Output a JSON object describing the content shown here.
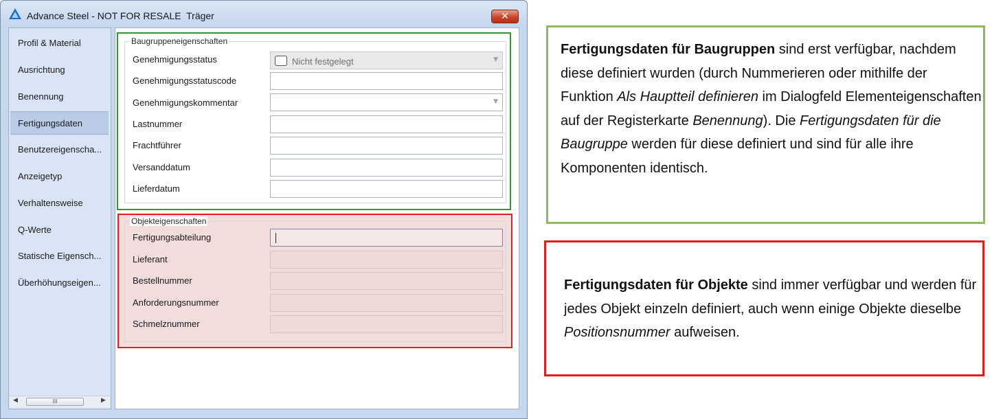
{
  "window": {
    "title": "Advance Steel - NOT FOR RESALE  Träger",
    "close_symbol": "✕"
  },
  "sidebar": {
    "items": [
      {
        "label": "Profil & Material"
      },
      {
        "label": "Ausrichtung"
      },
      {
        "label": "Benennung"
      },
      {
        "label": "Fertigungsdaten",
        "selected": true
      },
      {
        "label": "Benutzereigenscha..."
      },
      {
        "label": "Anzeigetyp"
      },
      {
        "label": "Verhaltensweise"
      },
      {
        "label": "Q-Werte"
      },
      {
        "label": "Statische Eigensch..."
      },
      {
        "label": "Überhöhungseigen..."
      }
    ],
    "scroll_left": "◀",
    "scroll_right": "▶",
    "scroll_thumb_grip": "III"
  },
  "assembly_group": {
    "legend": "Baugruppeneigenschaften",
    "fields": {
      "approval_status": {
        "label": "Genehmigungsstatus",
        "value": "Nicht festgelegt"
      },
      "approval_status_code": {
        "label": "Genehmigungsstatuscode",
        "value": ""
      },
      "approval_comment": {
        "label": "Genehmigungskommentar",
        "value": ""
      },
      "load_number": {
        "label": "Lastnummer",
        "value": ""
      },
      "carrier": {
        "label": "Frachtführer",
        "value": ""
      },
      "shipping_date": {
        "label": "Versanddatum",
        "value": ""
      },
      "delivery_date": {
        "label": "Lieferdatum",
        "value": ""
      }
    }
  },
  "object_group": {
    "legend": "Objekteigenschaften",
    "fields": {
      "production_department": {
        "label": "Fertigungsabteilung",
        "value": ""
      },
      "supplier": {
        "label": "Lieferant",
        "value": ""
      },
      "order_number": {
        "label": "Bestellnummer",
        "value": ""
      },
      "requisition_number": {
        "label": "Anforderungsnummer",
        "value": ""
      },
      "heat_number": {
        "label": "Schmelznummer",
        "value": ""
      }
    }
  },
  "callouts": {
    "assembly": {
      "bold_lead": "Fertigungsdaten für Baugruppen",
      "text_1": " sind erst verfügbar, nachdem diese definiert wurden (durch Nummerieren oder mithilfe der Funktion ",
      "italic_1": "Als Hauptteil definieren",
      "text_2": " im Dialogfeld Elementeigenschaften auf der Registerkarte ",
      "italic_2": "Benennung",
      "text_3": "). Die ",
      "italic_3": "Fertigungsdaten für die Baugruppe",
      "text_4": " werden für diese definiert und sind für alle ihre Komponenten identisch."
    },
    "object": {
      "bold_lead": "Fertigungsdaten für Objekte",
      "text_1": " sind immer verfügbar und werden für jedes Objekt einzeln definiert, auch wenn einige Objekte dieselbe ",
      "italic_1": "Positionsnummer",
      "text_2": " aufweisen."
    }
  },
  "colors": {
    "assembly_highlight": "#2e9a2e",
    "object_highlight": "#e02020",
    "callout_green_border": "#8fba5c",
    "callout_red_border": "#dd1f1f"
  }
}
